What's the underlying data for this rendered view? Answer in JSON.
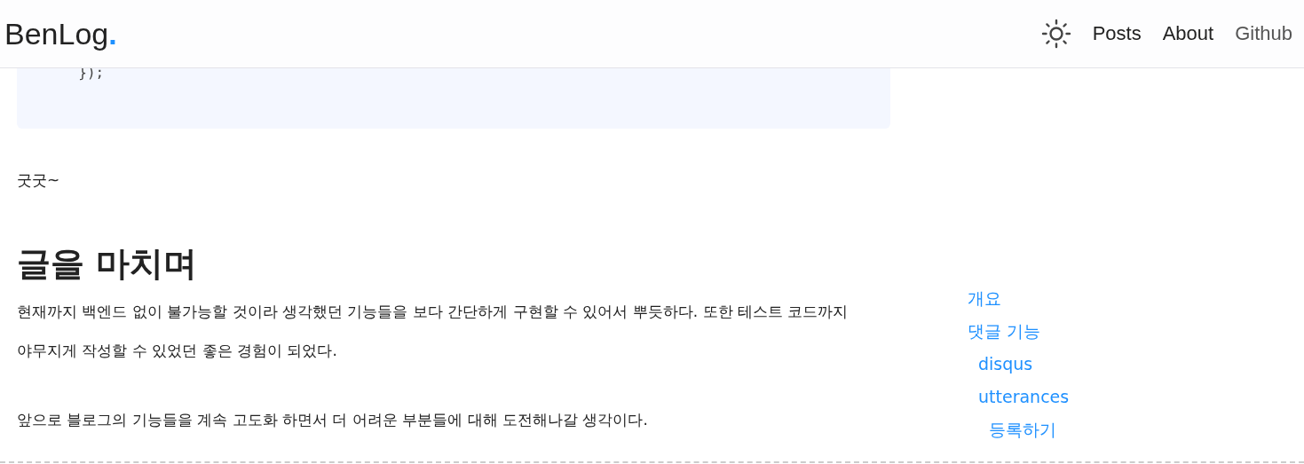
{
  "header": {
    "logo": "BenLog",
    "logo_dot": ".",
    "nav": [
      {
        "label": "Posts"
      },
      {
        "label": "About"
      },
      {
        "label": "Github"
      }
    ]
  },
  "code_block": {
    "lines": [
      "  });"
    ]
  },
  "content": [
    {
      "kind": "paragraph",
      "text": "굿굿~"
    },
    {
      "kind": "heading",
      "text": "글을 마치며"
    },
    {
      "kind": "paragraph",
      "text": "현재까지 백엔드 없이 불가능할 것이라 생각했던 기능들을 보다 간단하게 구현할 수 있어서 뿌듯하다. 또한 테스트 코드까지 야무지게 작성할 수 있었던 좋은 경험이 되었다."
    },
    {
      "kind": "paragraph",
      "text": "앞으로 블로그의 기능들을 계속 고도화 하면서 더 어려운 부분들에 대해 도전해나갈 생각이다."
    }
  ],
  "toc": [
    {
      "label": "개요"
    },
    {
      "label": "댓글 기능",
      "children": [
        {
          "label": "disqus"
        },
        {
          "label": "utterances",
          "children": [
            {
              "label": "등록하기"
            }
          ]
        }
      ]
    }
  ]
}
